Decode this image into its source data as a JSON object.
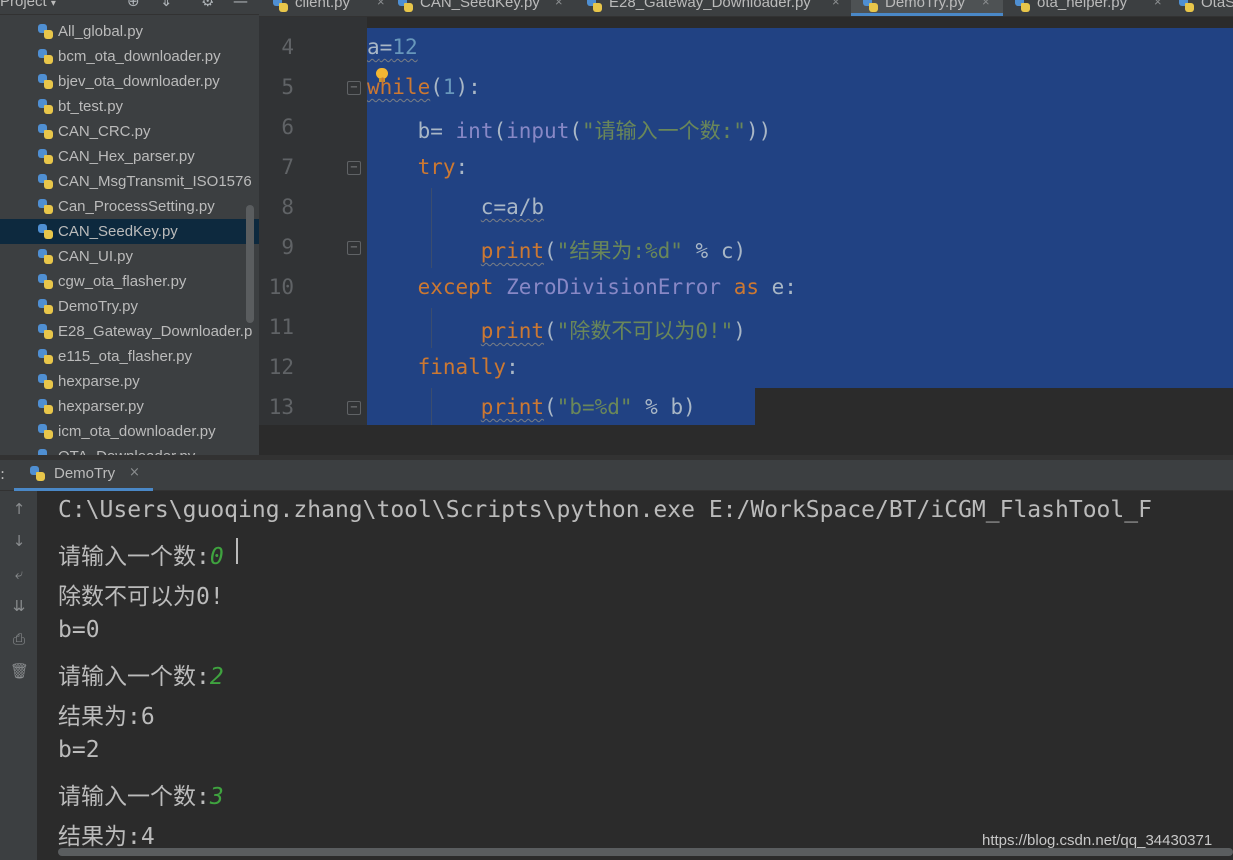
{
  "project_panel": {
    "title": "Project",
    "caret": "▾",
    "toolbar_icons": [
      "⊕",
      "⇕",
      "⚙",
      "—"
    ],
    "files": [
      {
        "name": "All_global.py",
        "selected": false
      },
      {
        "name": "bcm_ota_downloader.py",
        "selected": false
      },
      {
        "name": "bjev_ota_downloader.py",
        "selected": false
      },
      {
        "name": "bt_test.py",
        "selected": false
      },
      {
        "name": "CAN_CRC.py",
        "selected": false
      },
      {
        "name": "CAN_Hex_parser.py",
        "selected": false
      },
      {
        "name": "CAN_MsgTransmit_ISO1576",
        "selected": false
      },
      {
        "name": "Can_ProcessSetting.py",
        "selected": false
      },
      {
        "name": "CAN_SeedKey.py",
        "selected": true
      },
      {
        "name": "CAN_UI.py",
        "selected": false
      },
      {
        "name": "cgw_ota_flasher.py",
        "selected": false
      },
      {
        "name": "DemoTry.py",
        "selected": false
      },
      {
        "name": "E28_Gateway_Downloader.p",
        "selected": false
      },
      {
        "name": "e115_ota_flasher.py",
        "selected": false
      },
      {
        "name": "hexparse.py",
        "selected": false
      },
      {
        "name": "hexparser.py",
        "selected": false
      },
      {
        "name": "icm_ota_downloader.py",
        "selected": false
      },
      {
        "name": "OTA_Downloader.py",
        "selected": false
      }
    ]
  },
  "editor_tabs": [
    {
      "label": "client.py",
      "close": "×",
      "active": false
    },
    {
      "label": "CAN_SeedKey.py",
      "close": "×",
      "active": false
    },
    {
      "label": "E28_Gateway_Downloader.py",
      "close": "×",
      "active": false
    },
    {
      "label": "DemoTry.py",
      "close": "×",
      "active": true
    },
    {
      "label": "ota_helper.py",
      "close": "×",
      "active": false
    },
    {
      "label": "OtaS",
      "close": "",
      "active": false
    }
  ],
  "editor": {
    "line_numbers": [
      "4",
      "5",
      "6",
      "7",
      "8",
      "9",
      "10",
      "11",
      "12",
      "13"
    ],
    "fold_marker": "−",
    "code": {
      "l4_var": "a",
      "l4_eq": "=",
      "l4_num": "12",
      "l5_kw": "while",
      "l5_open": "(",
      "l5_num": "1",
      "l5_close": "):",
      "l6_var": "b",
      "l6_eq": "= ",
      "l6_int": "int",
      "l6_open": "(",
      "l6_input": "input",
      "l6_paren": "(",
      "l6_str": "\"请输入一个数:\"",
      "l6_close": "))",
      "l7_kw": "try",
      "l7_colon": ":",
      "l8_text": "c=a/b",
      "l9_fn": "print",
      "l9_open": "(",
      "l9_str": "\"结果为:%d\"",
      "l9_rest": " % c)",
      "l10_kw": "except",
      "l10_cls": "ZeroDivisionError",
      "l10_as": "as",
      "l10_rest": " e:",
      "l11_fn": "print",
      "l11_open": "(",
      "l11_str": "\"除数不可以为0!\"",
      "l11_close": ")",
      "l12_kw": "finally",
      "l12_colon": ":",
      "l13_fn": "print",
      "l13_open": "(",
      "l13_str": "\"b=%d\"",
      "l13_rest": " % b)"
    }
  },
  "run_panel": {
    "colon": ":",
    "tab_label": "DemoTry",
    "tab_close": "×",
    "side_icons": [
      "↑",
      "↓",
      "⤶",
      "⇊",
      "⎙",
      "🗑"
    ],
    "console": {
      "command": "C:\\Users\\guoqing.zhang\\tool\\Scripts\\python.exe E:/WorkSpace/BT/iCGM_FlashTool_F",
      "lines": [
        {
          "text": "请输入一个数:",
          "input": "0"
        },
        {
          "text": "除数不可以为0!",
          "input": ""
        },
        {
          "text": "b=0",
          "input": ""
        },
        {
          "text": "请输入一个数:",
          "input": "2"
        },
        {
          "text": "结果为:6",
          "input": ""
        },
        {
          "text": "b=2",
          "input": ""
        },
        {
          "text": "请输入一个数:",
          "input": "3"
        },
        {
          "text": "结果为:4",
          "input": ""
        }
      ]
    }
  },
  "watermark": "https://blog.csdn.net/qq_34430371",
  "colors": {
    "keyword": "#cc7832",
    "number": "#6897bb",
    "string": "#6a8759",
    "builtin": "#8888c6",
    "selection": "#214283",
    "user_input": "#3fa33f"
  }
}
